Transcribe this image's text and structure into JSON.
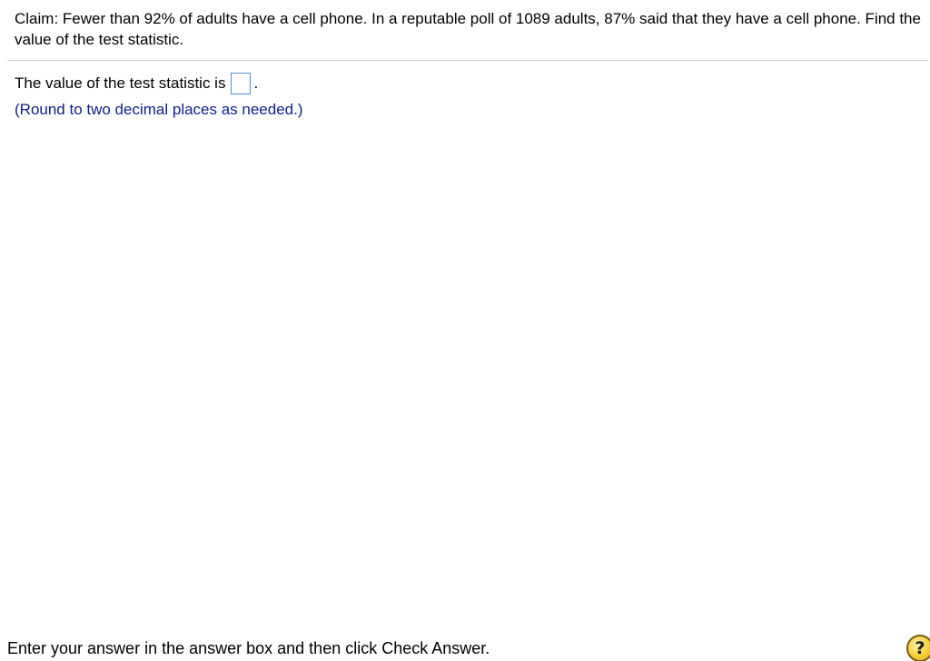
{
  "question": {
    "text": "Claim: Fewer than 92% of adults have a cell phone. In a reputable poll of 1089 adults, 87% said that they have a cell phone. Find the value of the test statistic."
  },
  "answer": {
    "prefix": "The value of the test statistic is",
    "value": "",
    "suffix": ".",
    "rounding_note": "(Round to two decimal places as needed.)"
  },
  "footer": {
    "instruction": "Enter your answer in the answer box and then click Check Answer.",
    "help_label": "?"
  },
  "colors": {
    "note_text": "#12208a",
    "answer_box_border": "#5a8ec8",
    "help_button": "#f5cf3c"
  },
  "icons": {
    "help": "help-question-icon"
  }
}
